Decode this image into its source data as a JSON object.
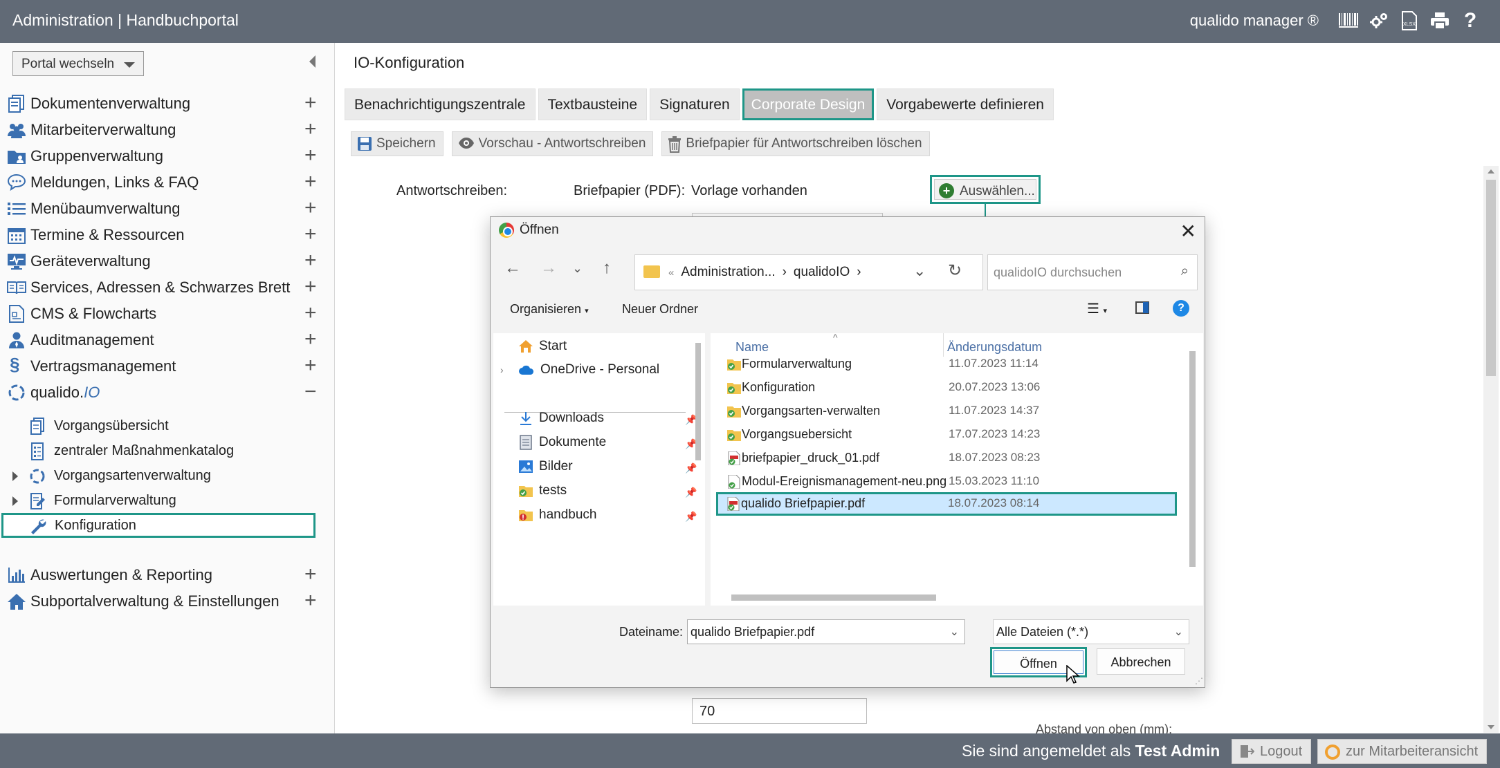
{
  "header": {
    "title": "Administration | Handbuchportal",
    "brand": "qualido manager ®",
    "icons": [
      "barcode-icon",
      "gears-icon",
      "xlsx-icon",
      "printer-icon",
      "help-icon"
    ]
  },
  "sidebar": {
    "portal_select": "Portal wechseln",
    "items": [
      {
        "label": "Dokumentenverwaltung",
        "icon": "documents-icon",
        "toggle": "+"
      },
      {
        "label": "Mitarbeiterverwaltung",
        "icon": "users-icon",
        "toggle": "+"
      },
      {
        "label": "Gruppenverwaltung",
        "icon": "group-folder-icon",
        "toggle": "+"
      },
      {
        "label": "Meldungen, Links & FAQ",
        "icon": "chat-icon",
        "toggle": "+"
      },
      {
        "label": "Menübaumverwaltung",
        "icon": "list-icon",
        "toggle": "+"
      },
      {
        "label": "Termine & Ressourcen",
        "icon": "calendar-icon",
        "toggle": "+"
      },
      {
        "label": "Geräteverwaltung",
        "icon": "monitor-icon",
        "toggle": "+"
      },
      {
        "label": "Services, Adressen & Schwarzes Brett",
        "icon": "book-icon",
        "toggle": "+"
      },
      {
        "label": "CMS & Flowcharts",
        "icon": "cms-icon",
        "toggle": "+"
      },
      {
        "label": "Auditmanagement",
        "icon": "auditor-icon",
        "toggle": "+"
      },
      {
        "label": "Vertragsmanagement",
        "icon": "paragraph-icon",
        "toggle": "+"
      },
      {
        "label_main": "qualido.",
        "label_suffix": "IO",
        "icon": "qualido-io-icon",
        "toggle": "−"
      },
      {
        "label": "Auswertungen & Reporting",
        "icon": "bar-chart-icon",
        "toggle": "+"
      },
      {
        "label": "Subportalverwaltung & Einstellungen",
        "icon": "home-icon",
        "toggle": "+"
      }
    ],
    "subitems": [
      {
        "label": "Vorgangsübersicht",
        "icon": "documents-icon"
      },
      {
        "label": "zentraler Maßnahmenkatalog",
        "icon": "catalog-icon"
      },
      {
        "label": "Vorgangsartenverwaltung",
        "icon": "cycle-icon"
      },
      {
        "label": "Formularverwaltung",
        "icon": "form-edit-icon"
      },
      {
        "label": "Konfiguration",
        "icon": "wrench-icon"
      }
    ]
  },
  "main": {
    "page_title": "IO-Konfiguration",
    "tabs": [
      "Benachrichtigungszentrale",
      "Textbausteine",
      "Signaturen",
      "Corporate Design",
      "Vorgabewerte definieren"
    ],
    "active_tab": "Corporate Design",
    "toolbar": {
      "save": "Speichern",
      "preview": "Vorschau - Antwortschreiben",
      "delete": "Briefpapier für Antwortschreiben löschen"
    },
    "form": {
      "antwort_label": "Antwortschreiben:",
      "briefpapier_label": "Briefpapier (PDF):",
      "briefpapier_status": "Vorlage vorhanden",
      "select_button": "Auswählen...",
      "abstand_label": "Abstand von oben (mm):",
      "abstand_value": "70"
    }
  },
  "dialog": {
    "title": "Öffnen",
    "breadcrumb": [
      "«",
      "Administration...",
      "›",
      "qualidoIO",
      "›"
    ],
    "search_placeholder": "qualidoIO durchsuchen",
    "organize": "Organisieren",
    "new_folder": "Neuer Ordner",
    "nav_items": [
      {
        "label": "Start",
        "icon": "home-icon"
      },
      {
        "label": "OneDrive - Personal",
        "icon": "cloud-icon"
      },
      {
        "label": "Downloads",
        "icon": "download-icon"
      },
      {
        "label": "Dokumente",
        "icon": "document-icon"
      },
      {
        "label": "Bilder",
        "icon": "image-icon"
      },
      {
        "label": "tests",
        "icon": "folder-icon"
      },
      {
        "label": "handbuch",
        "icon": "folder-alert-icon"
      }
    ],
    "columns": {
      "name": "Name",
      "date": "Änderungsdatum"
    },
    "files": [
      {
        "name": "Formularverwaltung",
        "date": "11.07.2023 11:14",
        "icon": "folder-icon"
      },
      {
        "name": "Konfiguration",
        "date": "20.07.2023 13:06",
        "icon": "folder-icon"
      },
      {
        "name": "Vorgangsarten-verwalten",
        "date": "11.07.2023 14:37",
        "icon": "folder-icon"
      },
      {
        "name": "Vorgangsuebersicht",
        "date": "17.07.2023 14:23",
        "icon": "folder-icon"
      },
      {
        "name": "briefpapier_druck_01.pdf",
        "date": "18.07.2023 08:23",
        "icon": "pdf-icon"
      },
      {
        "name": "Modul-Ereignismanagement-neu.png",
        "date": "15.03.2023 11:10",
        "icon": "png-icon"
      },
      {
        "name": "qualido Briefpapier.pdf",
        "date": "18.07.2023 08:14",
        "icon": "pdf-icon"
      }
    ],
    "selected_file": "qualido Briefpapier.pdf",
    "filename_label": "Dateiname:",
    "filename_value": "qualido Briefpapier.pdf",
    "filetype": "Alle Dateien (*.*)",
    "open_button": "Öffnen",
    "cancel_button": "Abbrechen"
  },
  "footer": {
    "login_prefix": "Sie sind angemeldet als ",
    "user": "Test Admin",
    "logout": "Logout",
    "employee_view": "zur Mitarbeiteransicht"
  },
  "colors": {
    "topbar": "#616a76",
    "accent": "#1e9688",
    "icon_blue": "#3a6fb0",
    "selection": "#cce8ff"
  }
}
